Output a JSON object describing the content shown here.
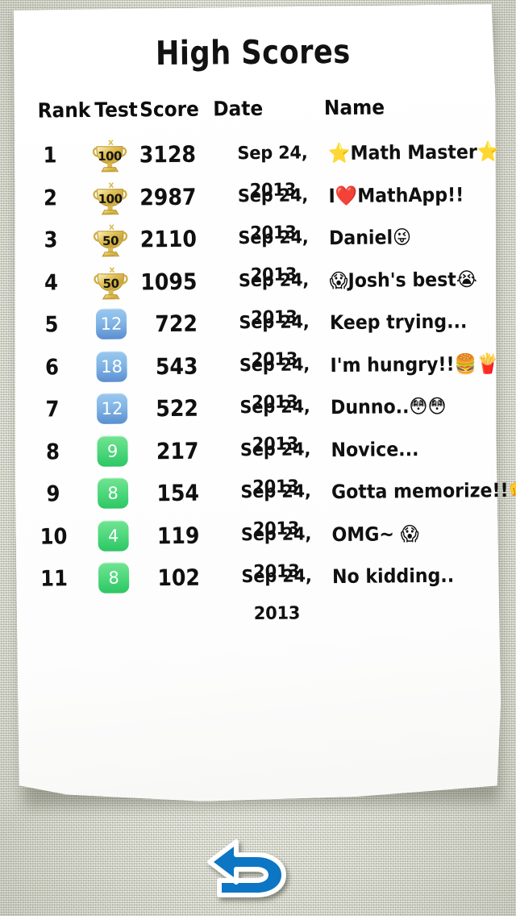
{
  "app": {
    "title": "High Scores",
    "background_color": "#d6d7c9",
    "paper_color": "#ffffff"
  },
  "table": {
    "columns": [
      "Rank",
      "Test",
      "Score",
      "Date",
      "Name"
    ],
    "rows": [
      {
        "rank": "1",
        "test": "100",
        "test_style": "trophy",
        "score": "3128",
        "date": "Sep 24, 2013",
        "name": "⭐Math Master⭐"
      },
      {
        "rank": "2",
        "test": "100",
        "test_style": "trophy",
        "score": "2987",
        "date": "Sep 24, 2013",
        "name": "I❤️MathApp!!"
      },
      {
        "rank": "3",
        "test": "50",
        "test_style": "trophy",
        "score": "2110",
        "date": "Sep 24, 2013",
        "name": "Daniel😜"
      },
      {
        "rank": "4",
        "test": "50",
        "test_style": "trophy",
        "score": "1095",
        "date": "Sep 24, 2013",
        "name": "😱Josh's best😭"
      },
      {
        "rank": "5",
        "test": "12",
        "test_style": "blue",
        "score": "722",
        "date": "Sep 24, 2013",
        "name": "Keep trying..."
      },
      {
        "rank": "6",
        "test": "18",
        "test_style": "blue",
        "score": "543",
        "date": "Sep 24, 2013",
        "name": "I'm hungry!!🍔🍟"
      },
      {
        "rank": "7",
        "test": "12",
        "test_style": "blue",
        "score": "522",
        "date": "Sep 24, 2013",
        "name": "Dunno..😳😳"
      },
      {
        "rank": "8",
        "test": "9",
        "test_style": "green",
        "score": "217",
        "date": "Sep 24, 2013",
        "name": "Novice..."
      },
      {
        "rank": "9",
        "test": "8",
        "test_style": "green",
        "score": "154",
        "date": "Sep 24, 2013",
        "name": "Gotta memorize!!👊"
      },
      {
        "rank": "10",
        "test": "4",
        "test_style": "green",
        "score": "119",
        "date": "Sep 24, 2013",
        "name": "OMG~ 😱"
      },
      {
        "rank": "11",
        "test": "8",
        "test_style": "green",
        "score": "102",
        "date": "Sep 24, 2013",
        "name": "No kidding.."
      }
    ]
  },
  "footer": {
    "back_icon": "back-arrow-icon",
    "back_color": "#0c76c4"
  }
}
